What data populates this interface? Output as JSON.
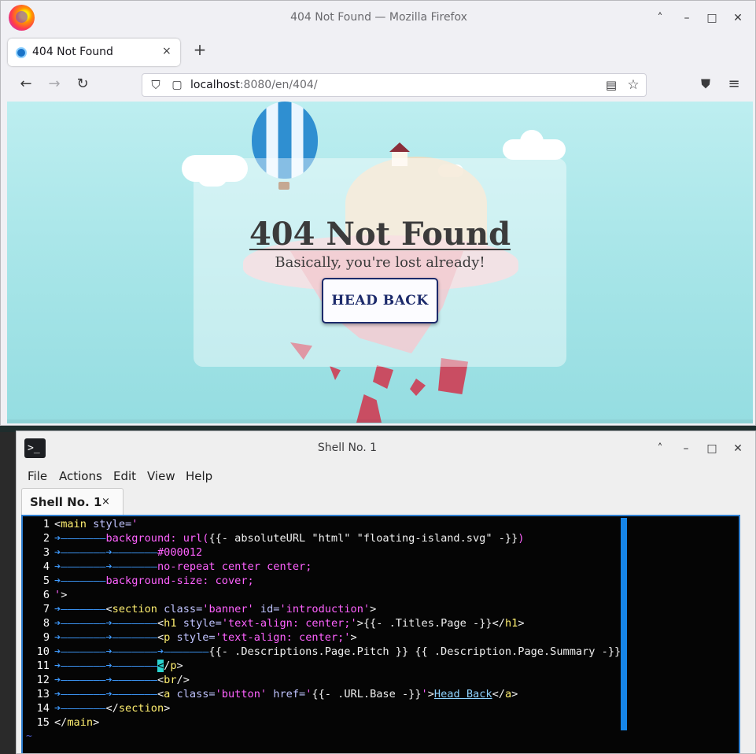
{
  "firefox": {
    "window_title": "404 Not Found — Mozilla Firefox",
    "tab_label": "404 Not Found",
    "tab_close": "×",
    "new_tab": "+",
    "url_host": "localhost",
    "url_path": ":8080/en/404/",
    "controls": {
      "minimize_up": "˄",
      "minimize": "–",
      "maximize": "□",
      "close": "✕"
    },
    "nav": {
      "back": "←",
      "forward": "→",
      "reload": "↻",
      "shield": "⛉",
      "reader": "▤",
      "star": "☆",
      "pocket": "⛊",
      "menu": "≡"
    }
  },
  "page": {
    "heading": "404 Not Found",
    "subtitle": "Basically, you're lost already!",
    "button": "HEAD BACK"
  },
  "terminal": {
    "window_title": "Shell No. 1",
    "icon_glyph": ">_",
    "menu": [
      "File",
      "Actions",
      "Edit",
      "View",
      "Help"
    ],
    "tab_label": "Shell No. 1",
    "tab_close": "×",
    "controls": {
      "minimize_up": "˄",
      "minimize": "–",
      "maximize": "□",
      "close": "✕"
    },
    "editor": {
      "tilde": "~",
      "lines": [
        {
          "n": "1",
          "segments": [
            [
              "tag",
              "<"
            ],
            [
              "kw",
              "main"
            ],
            [
              "attr",
              " style="
            ],
            [
              "str",
              "'"
            ]
          ]
        },
        {
          "n": "2",
          "segments": [
            [
              "arrow",
              "➔———————"
            ],
            [
              "str",
              "background: url("
            ],
            [
              "tpl",
              "{{- absoluteURL \"html\" \"floating-island.svg\" -}}"
            ],
            [
              "str",
              ")"
            ]
          ]
        },
        {
          "n": "3",
          "segments": [
            [
              "arrow",
              "➔———————➔———————"
            ],
            [
              "str",
              "#000012"
            ]
          ]
        },
        {
          "n": "4",
          "segments": [
            [
              "arrow",
              "➔———————➔———————"
            ],
            [
              "str",
              "no-repeat center center;"
            ]
          ]
        },
        {
          "n": "5",
          "segments": [
            [
              "arrow",
              "➔———————"
            ],
            [
              "str",
              "background-size: cover;"
            ]
          ]
        },
        {
          "n": "6",
          "segments": [
            [
              "str",
              "'"
            ],
            [
              "tag",
              ">"
            ]
          ]
        },
        {
          "n": "7",
          "segments": [
            [
              "arrow",
              "➔———————"
            ],
            [
              "tag",
              "<"
            ],
            [
              "kw",
              "section"
            ],
            [
              "attr",
              " class="
            ],
            [
              "str",
              "'banner'"
            ],
            [
              "attr",
              " id="
            ],
            [
              "str",
              "'introduction'"
            ],
            [
              "tag",
              ">"
            ]
          ]
        },
        {
          "n": "8",
          "segments": [
            [
              "arrow",
              "➔———————➔———————"
            ],
            [
              "tag",
              "<"
            ],
            [
              "kw",
              "h1"
            ],
            [
              "attr",
              " style="
            ],
            [
              "str",
              "'text-align: center;'"
            ],
            [
              "tag",
              ">"
            ],
            [
              "tpl",
              "{{- .Titles.Page -}}"
            ],
            [
              "tag",
              "</"
            ],
            [
              "kw",
              "h1"
            ],
            [
              "tag",
              ">"
            ]
          ]
        },
        {
          "n": "9",
          "segments": [
            [
              "arrow",
              "➔———————➔———————"
            ],
            [
              "tag",
              "<"
            ],
            [
              "kw",
              "p"
            ],
            [
              "attr",
              " style="
            ],
            [
              "str",
              "'text-align: center;'"
            ],
            [
              "tag",
              ">"
            ]
          ]
        },
        {
          "n": "10",
          "segments": [
            [
              "arrow",
              "➔———————➔———————➔———————"
            ],
            [
              "tpl",
              "{{- .Descriptions.Page.Pitch }} {{ .Description.Page.Summary -}}"
            ]
          ]
        },
        {
          "n": "11",
          "segments": [
            [
              "arrow",
              "➔———————➔———————"
            ],
            [
              "cursor",
              "<"
            ],
            [
              "tag",
              "/"
            ],
            [
              "kw",
              "p"
            ],
            [
              "tag",
              ">"
            ]
          ]
        },
        {
          "n": "12",
          "segments": [
            [
              "arrow",
              "➔———————➔———————"
            ],
            [
              "tag",
              "<"
            ],
            [
              "kw",
              "br"
            ],
            [
              "tag",
              "/>"
            ]
          ]
        },
        {
          "n": "13",
          "segments": [
            [
              "arrow",
              "➔———————➔———————"
            ],
            [
              "tag",
              "<"
            ],
            [
              "kw",
              "a"
            ],
            [
              "attr",
              " class="
            ],
            [
              "str",
              "'button'"
            ],
            [
              "attr",
              " href="
            ],
            [
              "str",
              "'"
            ],
            [
              "tpl",
              "{{- .URL.Base -}}"
            ],
            [
              "str",
              "'"
            ],
            [
              "tag",
              ">"
            ],
            [
              "link",
              "Head Back"
            ],
            [
              "tag",
              "</"
            ],
            [
              "kw",
              "a"
            ],
            [
              "tag",
              ">"
            ]
          ]
        },
        {
          "n": "14",
          "segments": [
            [
              "arrow",
              "➔———————"
            ],
            [
              "tag",
              "</"
            ],
            [
              "kw",
              "section"
            ],
            [
              "tag",
              ">"
            ]
          ]
        },
        {
          "n": "15",
          "segments": [
            [
              "tag",
              "</"
            ],
            [
              "kw",
              "main"
            ],
            [
              "tag",
              ">"
            ]
          ]
        }
      ]
    }
  }
}
